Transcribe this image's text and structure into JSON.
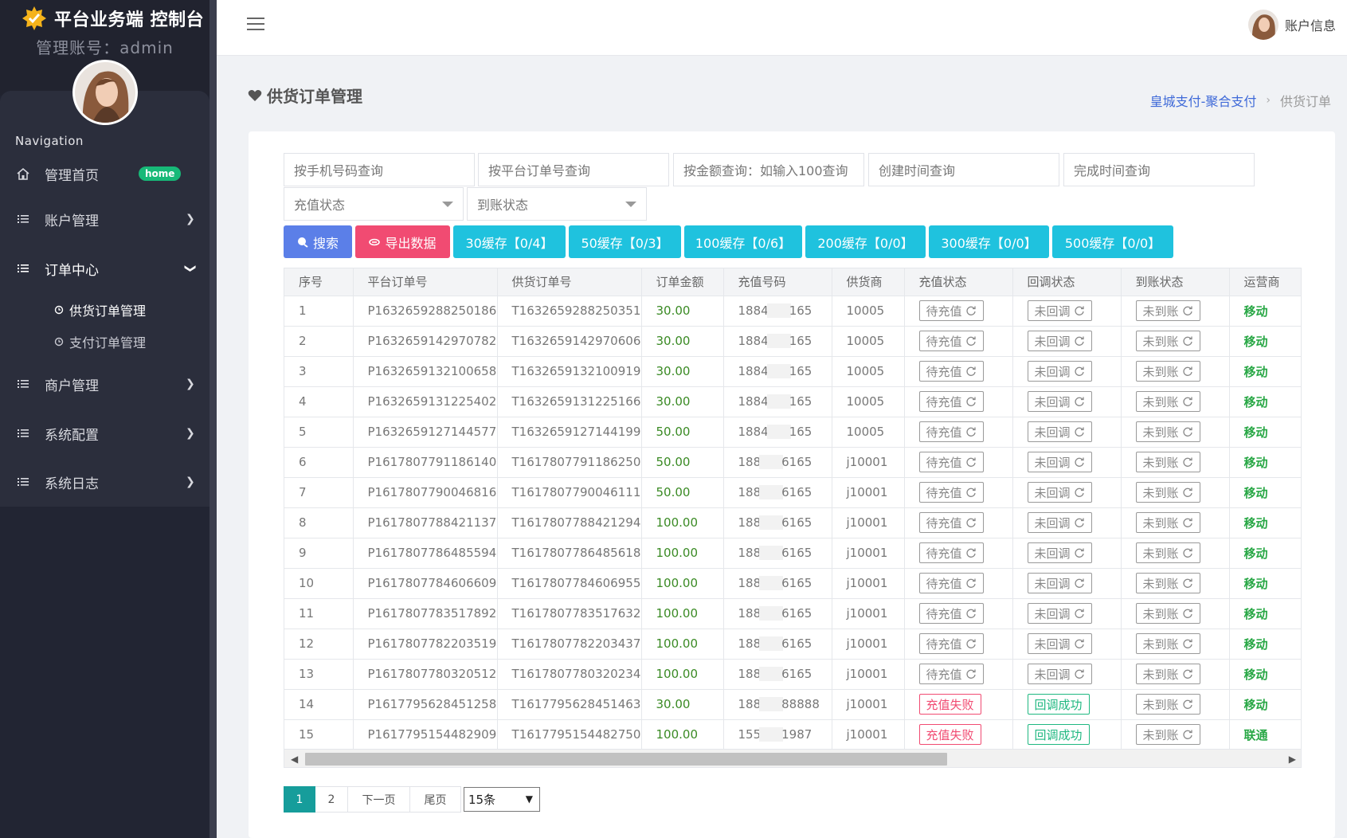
{
  "brand": {
    "title": "平台业务端 控制台",
    "admin_line": "管理账号：admin"
  },
  "sidebar": {
    "heading": "Navigation",
    "items": [
      {
        "label": "管理首页",
        "badge": "home"
      },
      {
        "label": "账户管理"
      },
      {
        "label": "订单中心"
      },
      {
        "label": "商户管理"
      },
      {
        "label": "系统配置"
      },
      {
        "label": "系统日志"
      }
    ],
    "sub_items": [
      {
        "label": "供货订单管理"
      },
      {
        "label": "支付订单管理"
      }
    ]
  },
  "header": {
    "account_label": "账户信息"
  },
  "page": {
    "title": "供货订单管理",
    "breadcrumb": {
      "link": "皇城支付-聚合支付",
      "separator": "›",
      "current": "供货订单"
    }
  },
  "filters": {
    "phone_placeholder": "按手机号码查询",
    "platform_order_placeholder": "按平台订单号查询",
    "amount_placeholder": "按金额查询：如输入100查询",
    "created_placeholder": "创建时间查询",
    "finished_placeholder": "完成时间查询",
    "recharge_status": "充值状态",
    "arrival_status": "到账状态"
  },
  "buttons": {
    "search": "搜索",
    "export": "导出数据",
    "cache30": "30缓存【0/4】",
    "cache50": "50缓存【0/3】",
    "cache100": "100缓存【0/6】",
    "cache200": "200缓存【0/0】",
    "cache300": "300缓存【0/0】",
    "cache500": "500缓存【0/0】"
  },
  "table": {
    "headers": [
      "序号",
      "平台订单号",
      "供货订单号",
      "订单金额",
      "充值号码",
      "供货商",
      "充值状态",
      "回调状态",
      "到账状态",
      "运营商"
    ],
    "rows": [
      [
        "1",
        "P1632659288250186",
        "T1632659288250351",
        "30.00",
        "1884",
        "165",
        "10005",
        "待充值",
        "未回调",
        "未到账",
        "移动"
      ],
      [
        "2",
        "P1632659142970782",
        "T1632659142970606",
        "30.00",
        "1884",
        "165",
        "10005",
        "待充值",
        "未回调",
        "未到账",
        "移动"
      ],
      [
        "3",
        "P1632659132100658",
        "T1632659132100919",
        "30.00",
        "1884",
        "165",
        "10005",
        "待充值",
        "未回调",
        "未到账",
        "移动"
      ],
      [
        "4",
        "P1632659131225402",
        "T1632659131225166",
        "30.00",
        "1884",
        "165",
        "10005",
        "待充值",
        "未回调",
        "未到账",
        "移动"
      ],
      [
        "5",
        "P1632659127144577",
        "T1632659127144199",
        "50.00",
        "1884",
        "165",
        "10005",
        "待充值",
        "未回调",
        "未到账",
        "移动"
      ],
      [
        "6",
        "P1617807791186140",
        "T1617807791186250",
        "50.00",
        "188",
        "6165",
        "j10001",
        "待充值",
        "未回调",
        "未到账",
        "移动"
      ],
      [
        "7",
        "P1617807790046816",
        "T1617807790046111",
        "50.00",
        "188",
        "6165",
        "j10001",
        "待充值",
        "未回调",
        "未到账",
        "移动"
      ],
      [
        "8",
        "P1617807788421137",
        "T1617807788421294",
        "100.00",
        "188",
        "6165",
        "j10001",
        "待充值",
        "未回调",
        "未到账",
        "移动"
      ],
      [
        "9",
        "P1617807786485594",
        "T1617807786485618",
        "100.00",
        "188",
        "6165",
        "j10001",
        "待充值",
        "未回调",
        "未到账",
        "移动"
      ],
      [
        "10",
        "P1617807784606609",
        "T1617807784606955",
        "100.00",
        "188",
        "6165",
        "j10001",
        "待充值",
        "未回调",
        "未到账",
        "移动"
      ],
      [
        "11",
        "P1617807783517892",
        "T1617807783517632",
        "100.00",
        "188",
        "6165",
        "j10001",
        "待充值",
        "未回调",
        "未到账",
        "移动"
      ],
      [
        "12",
        "P1617807782203519",
        "T1617807782203437",
        "100.00",
        "188",
        "6165",
        "j10001",
        "待充值",
        "未回调",
        "未到账",
        "移动"
      ],
      [
        "13",
        "P1617807780320512",
        "T1617807780320234",
        "100.00",
        "188",
        "6165",
        "j10001",
        "待充值",
        "未回调",
        "未到账",
        "移动"
      ],
      [
        "14",
        "P1617795628451258",
        "T1617795628451463",
        "30.00",
        "188",
        "88888",
        "j10001",
        "充值失败",
        "回调成功",
        "未到账",
        "移动"
      ],
      [
        "15",
        "P1617795154482909",
        "T1617795154482750",
        "100.00",
        "155",
        "1987",
        "j10001",
        "充值失败",
        "回调成功",
        "未到账",
        "联通"
      ]
    ]
  },
  "pagination": {
    "pages": [
      "1",
      "2"
    ],
    "next": "下一页",
    "last": "尾页",
    "page_size": "15条"
  },
  "colors": {
    "sidebar_bg": "#222533",
    "accent_blue": "#5b7fe8",
    "export_pink": "#f14b72",
    "cache_cyan": "#1fc2de",
    "pager_active": "#169d9b",
    "amount_green": "#3a8a24"
  }
}
